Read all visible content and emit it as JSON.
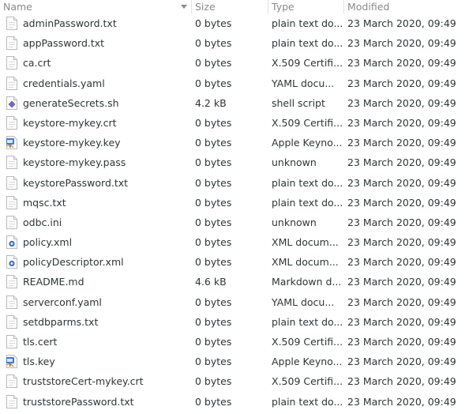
{
  "columns": {
    "name": "Name",
    "size": "Size",
    "type": "Type",
    "modified": "Modified"
  },
  "files": [
    {
      "name": "adminPassword.txt",
      "size": "0 bytes",
      "type": "plain text do...",
      "modified": "23 March 2020, 09:49",
      "icon": "text-file-icon"
    },
    {
      "name": "appPassword.txt",
      "size": "0 bytes",
      "type": "plain text do...",
      "modified": "23 March 2020, 09:49",
      "icon": "text-file-icon"
    },
    {
      "name": "ca.crt",
      "size": "0 bytes",
      "type": "X.509 Certifi...",
      "modified": "23 March 2020, 09:49",
      "icon": "text-file-icon"
    },
    {
      "name": "credentials.yaml",
      "size": "0 bytes",
      "type": "YAML docu...",
      "modified": "23 March 2020, 09:49",
      "icon": "text-file-icon"
    },
    {
      "name": "generateSecrets.sh",
      "size": "4.2 kB",
      "type": "shell script",
      "modified": "23 March 2020, 09:49",
      "icon": "script-file-icon"
    },
    {
      "name": "keystore-mykey.crt",
      "size": "0 bytes",
      "type": "X.509 Certifi...",
      "modified": "23 March 2020, 09:49",
      "icon": "text-file-icon"
    },
    {
      "name": "keystore-mykey.key",
      "size": "0 bytes",
      "type": "Apple Keyno...",
      "modified": "23 March 2020, 09:49",
      "icon": "keynote-file-icon"
    },
    {
      "name": "keystore-mykey.pass",
      "size": "0 bytes",
      "type": "unknown",
      "modified": "23 March 2020, 09:49",
      "icon": "text-file-icon"
    },
    {
      "name": "keystorePassword.txt",
      "size": "0 bytes",
      "type": "plain text do...",
      "modified": "23 March 2020, 09:49",
      "icon": "text-file-icon"
    },
    {
      "name": "mqsc.txt",
      "size": "0 bytes",
      "type": "plain text do...",
      "modified": "23 March 2020, 09:49",
      "icon": "text-file-icon"
    },
    {
      "name": "odbc.ini",
      "size": "0 bytes",
      "type": "unknown",
      "modified": "23 March 2020, 09:49",
      "icon": "text-file-icon"
    },
    {
      "name": "policy.xml",
      "size": "0 bytes",
      "type": "XML docum...",
      "modified": "23 March 2020, 09:49",
      "icon": "xml-file-icon"
    },
    {
      "name": "policyDescriptor.xml",
      "size": "0 bytes",
      "type": "XML docum...",
      "modified": "23 March 2020, 09:49",
      "icon": "xml-file-icon"
    },
    {
      "name": "README.md",
      "size": "4.6 kB",
      "type": "Markdown d...",
      "modified": "23 March 2020, 09:49",
      "icon": "text-file-icon"
    },
    {
      "name": "serverconf.yaml",
      "size": "0 bytes",
      "type": "YAML docu...",
      "modified": "23 March 2020, 09:49",
      "icon": "text-file-icon"
    },
    {
      "name": "setdbparms.txt",
      "size": "0 bytes",
      "type": "plain text do...",
      "modified": "23 March 2020, 09:49",
      "icon": "text-file-icon"
    },
    {
      "name": "tls.cert",
      "size": "0 bytes",
      "type": "X.509 Certifi...",
      "modified": "23 March 2020, 09:49",
      "icon": "text-file-icon"
    },
    {
      "name": "tls.key",
      "size": "0 bytes",
      "type": "Apple Keyno...",
      "modified": "23 March 2020, 09:49",
      "icon": "keynote-file-icon"
    },
    {
      "name": "truststoreCert-mykey.crt",
      "size": "0 bytes",
      "type": "X.509 Certifi...",
      "modified": "23 March 2020, 09:49",
      "icon": "text-file-icon"
    },
    {
      "name": "truststorePassword.txt",
      "size": "0 bytes",
      "type": "plain text do...",
      "modified": "23 March 2020, 09:49",
      "icon": "text-file-icon"
    }
  ]
}
